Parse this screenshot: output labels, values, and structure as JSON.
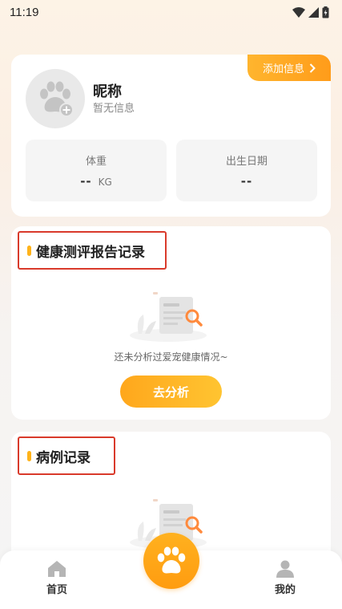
{
  "status_bar": {
    "time": "11:19"
  },
  "profile": {
    "add_info_label": "添加信息",
    "nickname": "昵称",
    "subtitle": "暂无信息",
    "weight": {
      "label": "体重",
      "value": "--",
      "unit": "KG"
    },
    "birth": {
      "label": "出生日期",
      "value": "--"
    }
  },
  "health_section": {
    "title": "健康测评报告记录",
    "empty_text": "还未分析过爱宠健康情况~",
    "action_label": "去分析"
  },
  "case_section": {
    "title": "病例记录"
  },
  "bottom_nav": {
    "items": [
      {
        "label": "首页",
        "icon": "home-icon"
      },
      {
        "label": "我的",
        "icon": "profile-icon"
      }
    ],
    "center_icon": "paw-icon"
  },
  "colors": {
    "accent": "#ffa71c",
    "highlight_border": "#d93a2b"
  }
}
